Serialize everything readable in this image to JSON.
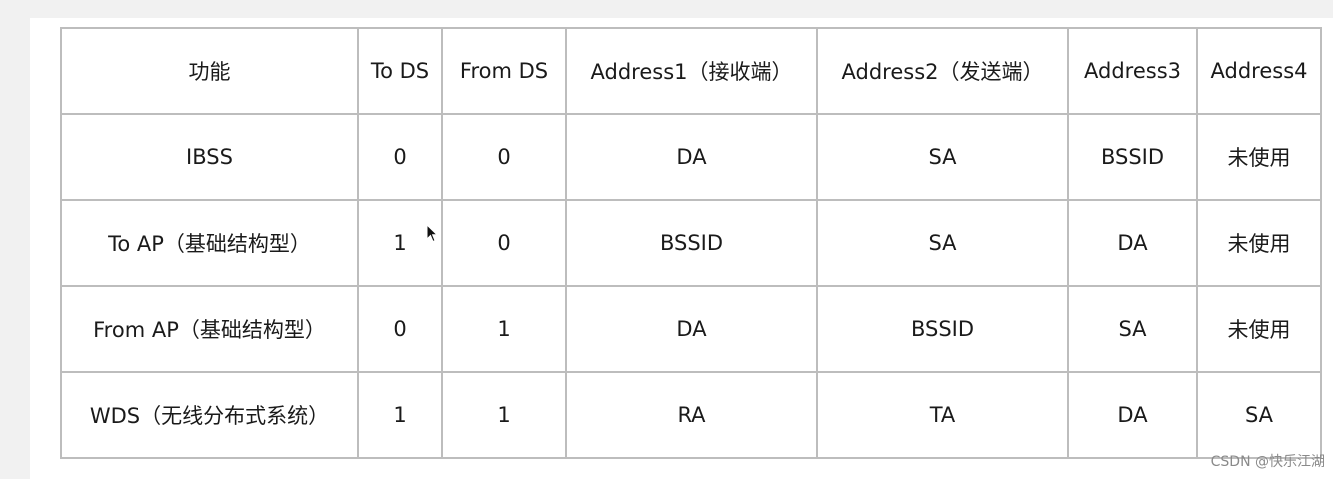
{
  "table": {
    "headers": [
      "功能",
      "To DS",
      "From DS",
      "Address1（接收端）",
      "Address2（发送端）",
      "Address3",
      "Address4"
    ],
    "rows": [
      [
        "IBSS",
        "0",
        "0",
        "DA",
        "SA",
        "BSSID",
        "未使用"
      ],
      [
        "To AP（基础结构型）",
        "1",
        "0",
        "BSSID",
        "SA",
        "DA",
        "未使用"
      ],
      [
        "From AP（基础结构型）",
        "0",
        "1",
        "DA",
        "BSSID",
        "SA",
        "未使用"
      ],
      [
        "WDS（无线分布式系统）",
        "1",
        "1",
        "RA",
        "TA",
        "DA",
        "SA"
      ]
    ]
  },
  "watermark": "CSDN @快乐江湖"
}
